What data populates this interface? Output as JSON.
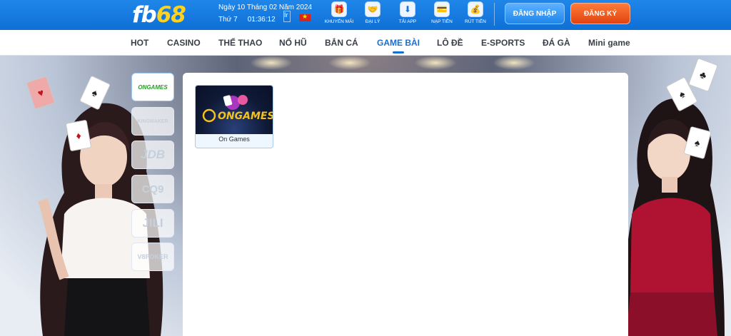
{
  "header": {
    "logo_white": "fb",
    "logo_yellow": "68",
    "date_line": "Ngày 10 Tháng 02 Năm 2024",
    "weekday": "Thứ 7",
    "time": "01:36:12",
    "lang_img_alt": "Ir",
    "quick_nav": [
      {
        "label": "KHUYẾN MÃI",
        "icon": "gift-icon",
        "glyph": "🎁"
      },
      {
        "label": "ĐẠI LÝ",
        "icon": "handshake-icon",
        "glyph": "🤝"
      },
      {
        "label": "TẢI APP",
        "icon": "download-app-icon",
        "glyph": "⬇"
      },
      {
        "label": "NẠP TIỀN",
        "icon": "wallet-icon",
        "glyph": "💳"
      },
      {
        "label": "RÚT TIỀN",
        "icon": "withdraw-icon",
        "glyph": "💰"
      }
    ],
    "login_label": "ĐĂNG NHẬP",
    "register_label": "ĐĂNG KÝ"
  },
  "nav": {
    "items": [
      {
        "label": "HOT"
      },
      {
        "label": "CASINO"
      },
      {
        "label": "THỂ THAO"
      },
      {
        "label": "NỔ HŨ"
      },
      {
        "label": "BẮN CÁ"
      },
      {
        "label": "GAME BÀI"
      },
      {
        "label": "LÔ ĐỀ"
      },
      {
        "label": "E-SPORTS"
      },
      {
        "label": "ĐÁ GÀ"
      },
      {
        "label": "Mini game"
      }
    ],
    "active": "GAME BÀI"
  },
  "providers": [
    {
      "label": "ONGAMES",
      "active": true
    },
    {
      "label": "KINGMAKER",
      "active": false
    },
    {
      "label": "JDB",
      "active": false
    },
    {
      "label": "CQ9",
      "active": false
    },
    {
      "label": "JILI",
      "active": false
    },
    {
      "label": "V8POKER",
      "active": false
    }
  ],
  "games": [
    {
      "name": "On Games",
      "logo_text": "ONGAMES"
    }
  ],
  "colors": {
    "header_blue": "#1475de",
    "accent_blue": "#1a6fd3",
    "login_blue": "#2a8cf0",
    "register_orange": "#e8541a",
    "logo_yellow": "#ffd21f"
  }
}
